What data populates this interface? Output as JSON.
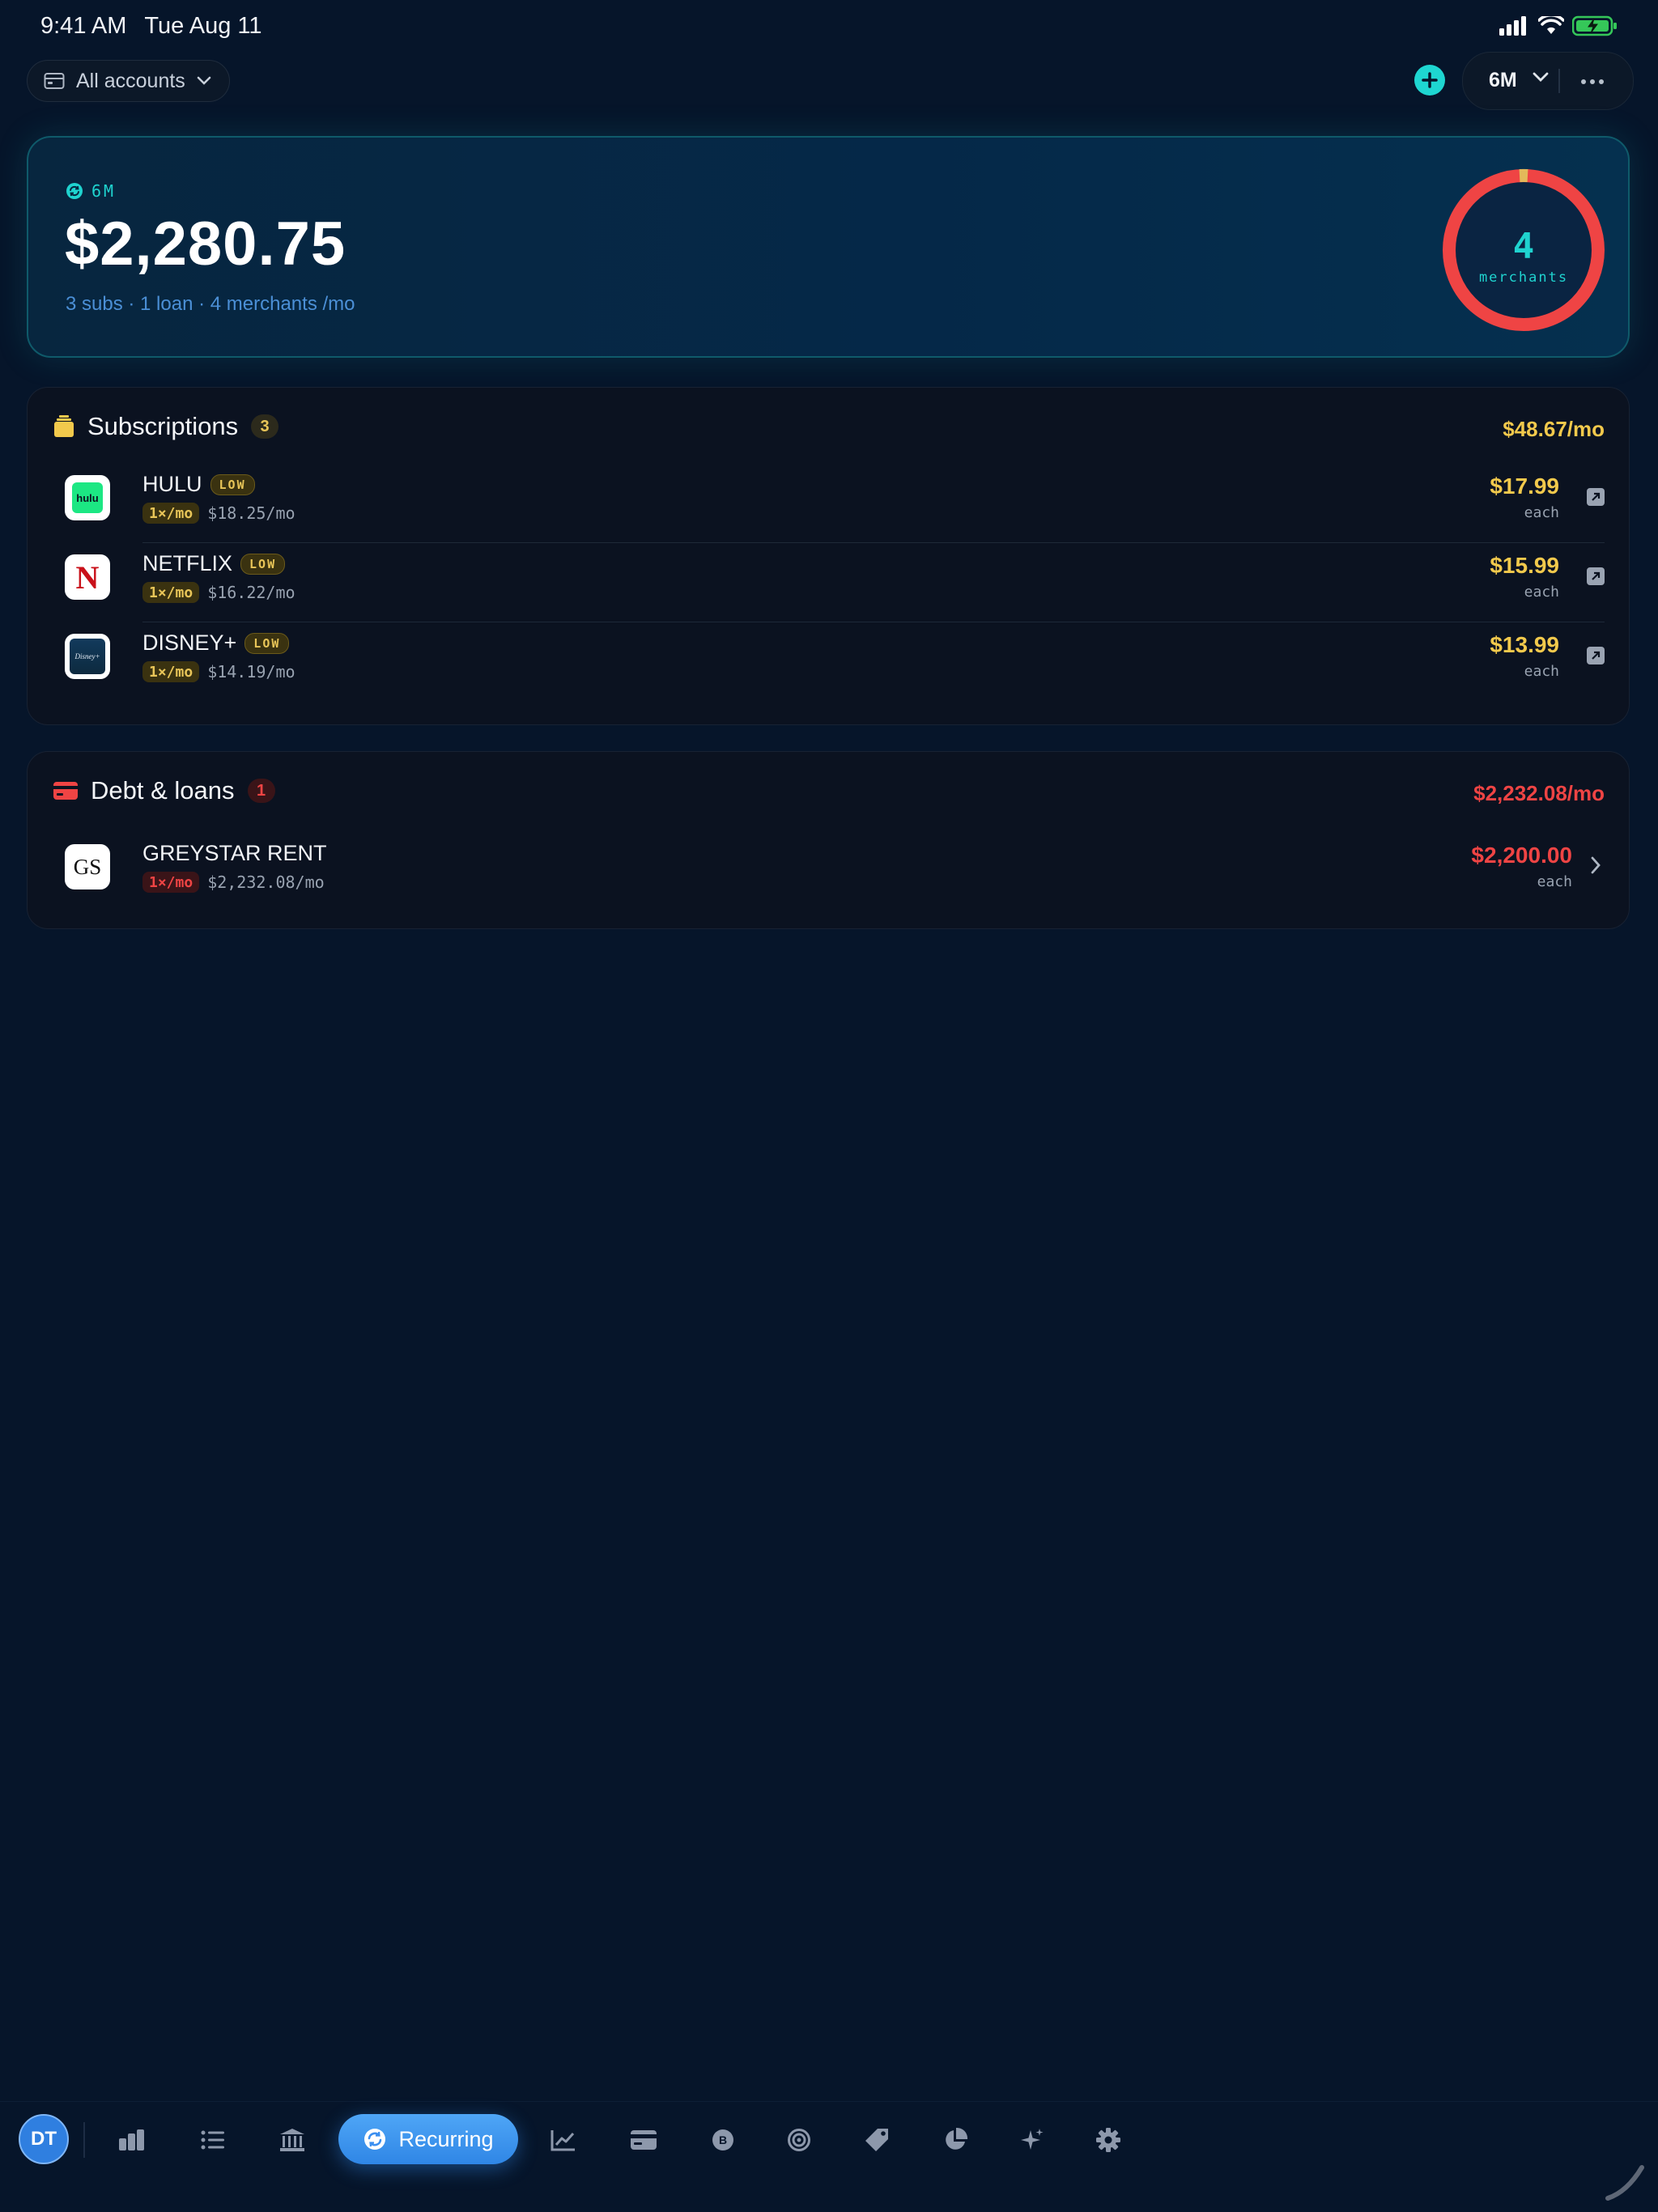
{
  "status_bar": {
    "time": "9:41 AM",
    "date": "Tue Aug 11"
  },
  "toolbar": {
    "accounts_label": "All accounts",
    "period_label": "6M"
  },
  "summary": {
    "period_tag": "6M",
    "amount": "$2,280.75",
    "subtitle": "3 subs · 1 loan · 4 merchants /mo",
    "merchant_count": "4",
    "merchant_label": "merchants"
  },
  "subscriptions": {
    "title": "Subscriptions",
    "count": "3",
    "total": "$48.67/mo",
    "items": [
      {
        "name": "HULU",
        "badge": "LOW",
        "freq": "1×/mo",
        "monthly": "$18.25/mo",
        "price": "$17.99",
        "each": "each",
        "logo_text": "hulu"
      },
      {
        "name": "NETFLIX",
        "badge": "LOW",
        "freq": "1×/mo",
        "monthly": "$16.22/mo",
        "price": "$15.99",
        "each": "each",
        "logo_text": "N"
      },
      {
        "name": "DISNEY+",
        "badge": "LOW",
        "freq": "1×/mo",
        "monthly": "$14.19/mo",
        "price": "$13.99",
        "each": "each",
        "logo_text": "Disney+"
      }
    ]
  },
  "debt": {
    "title": "Debt & loans",
    "count": "1",
    "total": "$2,232.08/mo",
    "items": [
      {
        "name": "GREYSTAR RENT",
        "freq": "1×/mo",
        "monthly": "$2,232.08/mo",
        "price": "$2,200.00",
        "each": "each",
        "logo_text": "GS"
      }
    ]
  },
  "nav": {
    "avatar_initials": "DT",
    "active_label": "Recurring",
    "icons": [
      "bar-chart-icon",
      "list-icon",
      "bank-icon",
      "recurring-icon",
      "trend-icon",
      "card-icon",
      "bitcoin-icon",
      "target-icon",
      "tag-icon",
      "pie-chart-icon",
      "sparkle-icon",
      "gear-icon"
    ]
  },
  "colors": {
    "background": "#06152a",
    "accent_teal": "#1ed6d1",
    "subscriptions_gold": "#f2c94c",
    "debt_red": "#ef4444",
    "active_blue": "#3b8ff0"
  }
}
